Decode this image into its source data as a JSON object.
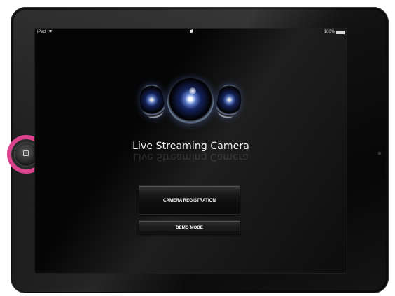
{
  "status_bar": {
    "device_label": "iPad",
    "battery_text": "100%"
  },
  "app": {
    "title": "Live Streaming Camera",
    "buttons": {
      "camera_registration": "CAMERA REGISTRATION",
      "demo_mode": "DEMO MODE"
    }
  },
  "icons": {
    "status": [
      "wifi-icon",
      "lock-icon",
      "battery-icon"
    ],
    "hardware": [
      "home-button-icon"
    ],
    "logo": [
      "camera-lens-icon"
    ]
  },
  "colors": {
    "highlight_ring": "#d9448d",
    "screen_bg": "#050505",
    "button_text": "#ffffff"
  }
}
